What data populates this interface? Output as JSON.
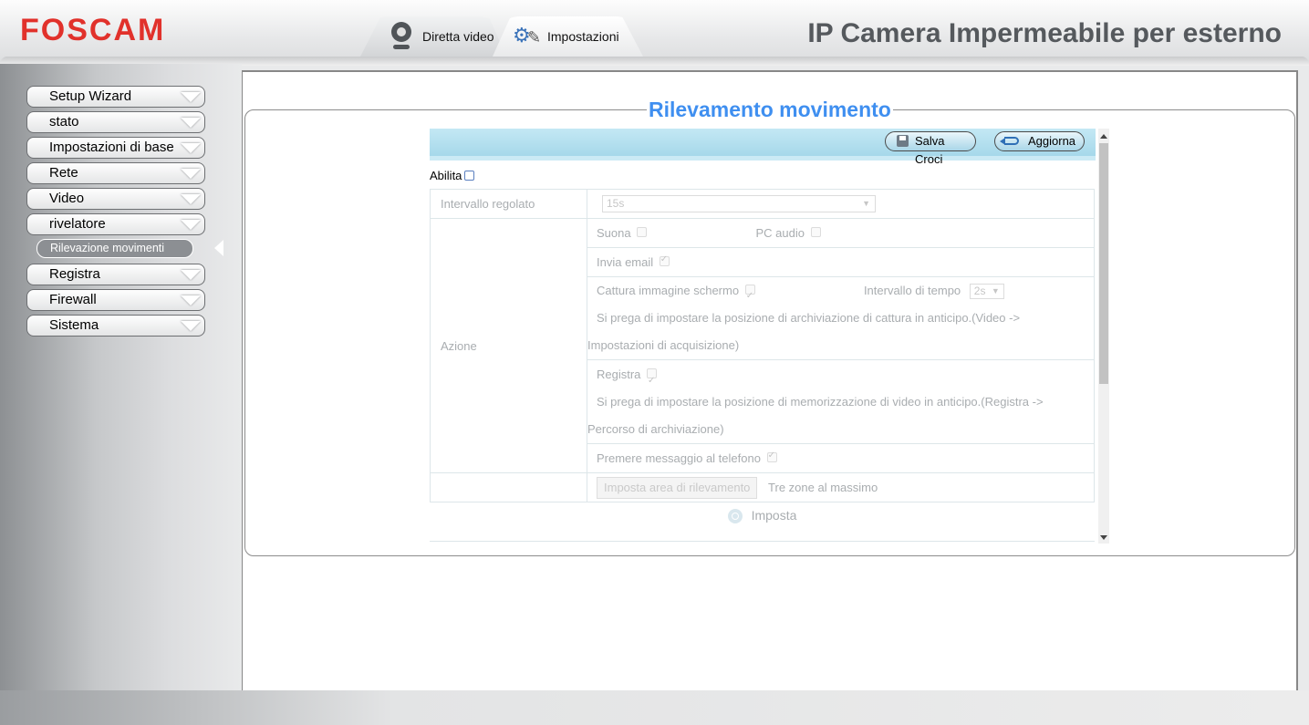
{
  "header": {
    "logo": "FOSCAM",
    "title": "IP Camera Impermeabile per esterno",
    "tabs": [
      {
        "label": "Diretta video",
        "icon": "webcam-icon"
      },
      {
        "label": "Impostazioni",
        "icon": "gear-wrench-icon"
      }
    ]
  },
  "sidebar": {
    "items": [
      {
        "label": "Setup Wizard"
      },
      {
        "label": "stato"
      },
      {
        "label": "Impostazioni di base"
      },
      {
        "label": "Rete"
      },
      {
        "label": "Video"
      },
      {
        "label": "rivelatore"
      },
      {
        "label": "Registra"
      },
      {
        "label": "Firewall"
      },
      {
        "label": "Sistema"
      }
    ],
    "active_sub_item": "Rilevazione movimenti"
  },
  "page": {
    "title": "Rilevamento movimento",
    "toolbar": {
      "save_label": "Salva Croci",
      "refresh_label": "Aggiorna"
    },
    "enable_label": "Abilita",
    "interval_label": "Intervallo regolato",
    "interval_value": "15s",
    "action_label": "Azione",
    "sound_label": "Suona",
    "pc_audio_label": "PC audio",
    "email_label": "Invia email",
    "snapshot_label": "Cattura immagine schermo",
    "time_interval_label": "Intervallo di tempo",
    "time_interval_value": "2s",
    "snapshot_note_1": "Si prega di impostare la posizione di archiviazione di cattura in anticipo.(Video ->",
    "snapshot_note_2": "Impostazioni di acquisizione)",
    "record_label": "Registra",
    "record_note_1": "Si prega di impostare la posizione di memorizzazione di video in anticipo.(Registra ->",
    "record_note_2": "Percorso di archiviazione)",
    "push_label": "Premere messaggio al telefono",
    "area_button": "Imposta area di rilevamento",
    "area_note": "Tre zone al massimo",
    "set_label": "Imposta"
  },
  "colors": {
    "brand": "#e1312b",
    "title": "#3f8ff0",
    "toolbar": "#a6d8ea"
  }
}
